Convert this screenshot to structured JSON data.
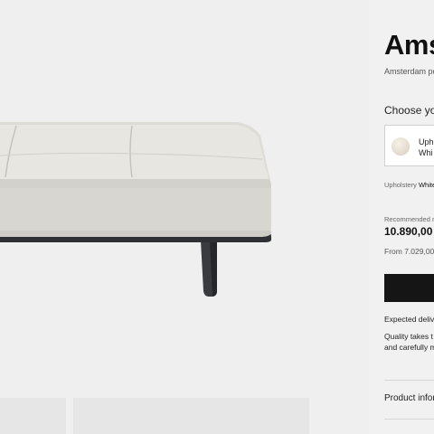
{
  "product": {
    "title": "Ams",
    "subtitle": "Amsterdam po",
    "choose_label": "Choose your",
    "upholstery_card": {
      "line1": "Uph",
      "line2": "Whi",
      "swatch_icon": "fabric-swatch-icon"
    },
    "upholstery_label": "Upholstery",
    "upholstery_value": "White",
    "recommended_label": "Recommended r",
    "price": "10.890,00",
    "from_price": "From 7.029,00",
    "expected_delivery": "Expected deliv",
    "quality_line1": "Quality takes t",
    "quality_line2": "and carefully m",
    "product_info": "Product infor"
  },
  "colors": {
    "page_background": "#f1f1f1",
    "button": "#151515"
  }
}
